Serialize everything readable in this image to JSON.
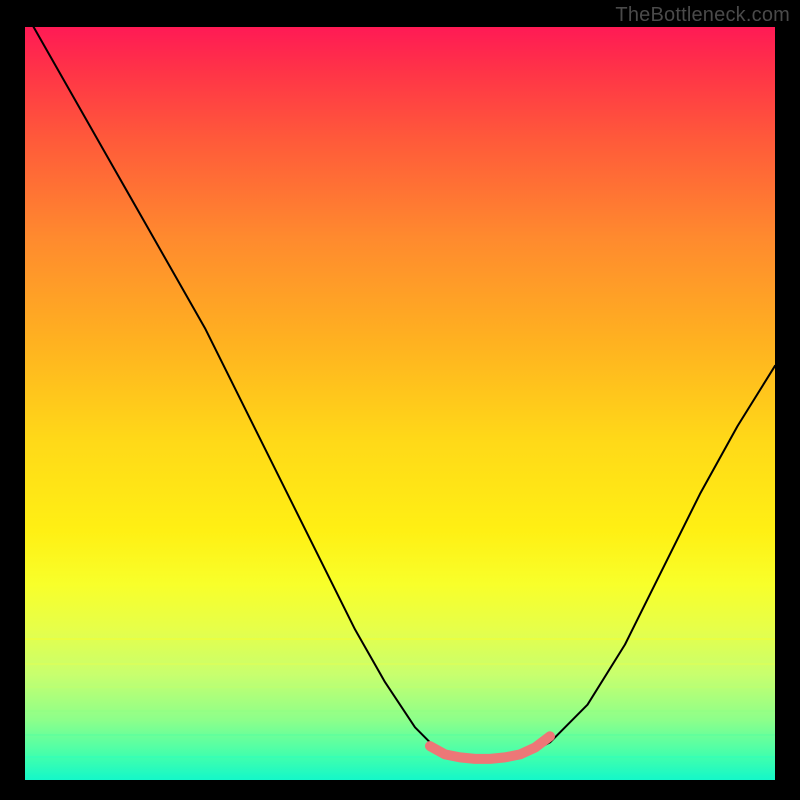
{
  "watermark": "TheBottleneck.com",
  "colors": {
    "frame": "#000000",
    "curve_stroke": "#000000",
    "highlight_stroke": "#ed7777",
    "gradient_top": "#ff1a55",
    "gradient_bottom": "#14f7c9"
  },
  "chart_data": {
    "type": "line",
    "title": "",
    "xlabel": "",
    "ylabel": "",
    "xlim": [
      0,
      100
    ],
    "ylim": [
      0,
      100
    ],
    "grid": false,
    "series": [
      {
        "name": "bottleneck-curve",
        "x": [
          0,
          4,
          8,
          12,
          16,
          20,
          24,
          28,
          32,
          36,
          40,
          44,
          48,
          52,
          55,
          58,
          61,
          63,
          66,
          70,
          75,
          80,
          85,
          90,
          95,
          100
        ],
        "y": [
          102,
          95,
          88,
          81,
          74,
          67,
          60,
          52,
          44,
          36,
          28,
          20,
          13,
          7,
          4,
          3,
          3,
          3,
          3,
          5,
          10,
          18,
          28,
          38,
          47,
          55
        ]
      },
      {
        "name": "optimal-zone-highlight",
        "x": [
          54,
          56,
          58,
          60,
          62,
          64,
          66,
          68,
          70
        ],
        "y": [
          4.5,
          3.4,
          3.0,
          2.8,
          2.8,
          3.0,
          3.4,
          4.3,
          5.8
        ]
      }
    ],
    "annotations": []
  }
}
